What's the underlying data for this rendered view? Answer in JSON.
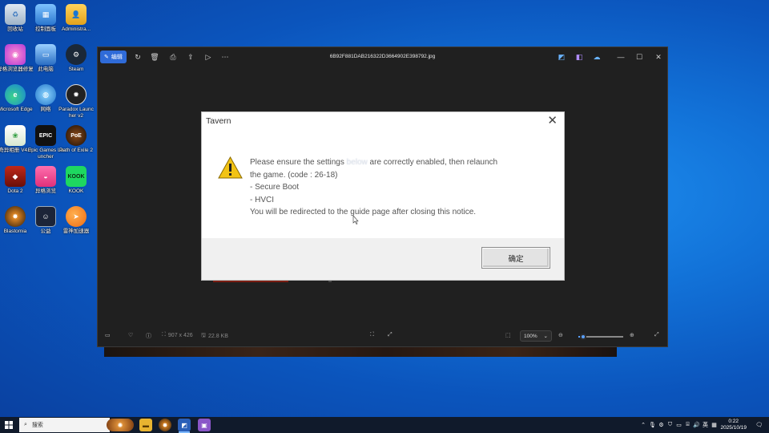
{
  "desktop": {
    "icons": [
      {
        "label": "回收站",
        "icon": "recycle-bin-icon"
      },
      {
        "label": "控制面板",
        "icon": "control-panel-icon"
      },
      {
        "label": "Administra...",
        "icon": "user-folder-icon"
      },
      {
        "label": "异格浏览器修复",
        "icon": "browser-repair-icon"
      },
      {
        "label": "此电脑",
        "icon": "this-pc-icon"
      },
      {
        "label": "Steam",
        "icon": "steam-icon"
      },
      {
        "label": "Microsoft Edge",
        "icon": "edge-icon"
      },
      {
        "label": "网络",
        "icon": "network-icon"
      },
      {
        "label": "Paradox Launcher v2",
        "icon": "paradox-launcher-icon"
      },
      {
        "label": "奇异相册 V4.2",
        "icon": "photo-album-icon"
      },
      {
        "label": "Epic Games Launcher",
        "icon": "epic-games-icon"
      },
      {
        "label": "Path of Exile 2",
        "icon": "path-of-exile-icon"
      },
      {
        "label": "Dota 2",
        "icon": "dota2-icon"
      },
      {
        "label": "异格浏览",
        "icon": "browser-icon"
      },
      {
        "label": "KOOK",
        "icon": "kook-icon"
      },
      {
        "label": "Blastomia",
        "icon": "blastomia-icon"
      },
      {
        "label": "公益",
        "icon": "charity-icon"
      },
      {
        "label": "雷神加速器",
        "icon": "leishen-accelerator-icon"
      }
    ]
  },
  "viewer": {
    "edit_label": "编辑",
    "file_name": "6B92F881DAB216322D3664902E398792.jpg",
    "image_size": "907 x 426",
    "file_size": "22.8 KB",
    "zoom_value": "100%",
    "zoom_level": 0.1
  },
  "dialog": {
    "title": "Tavern",
    "line1_a": "Please ensure the settings ",
    "line1_blur": "below",
    "line1_b": " are correctly enabled, then relaunch",
    "line2": "the game. (code : 26-18)",
    "line3": "- Secure Boot",
    "line4": "- HVCI",
    "line5": "You will be redirected to the guide page after closing this notice.",
    "ok_label": "确定"
  },
  "taskbar": {
    "search_placeholder": "搜索",
    "ime_label": "英",
    "time": "0:22",
    "date": "2025/10/19"
  },
  "colors": {
    "accent": "#2f6bd8",
    "desktop": "#1272d8",
    "taskbar": "#101a2b"
  }
}
